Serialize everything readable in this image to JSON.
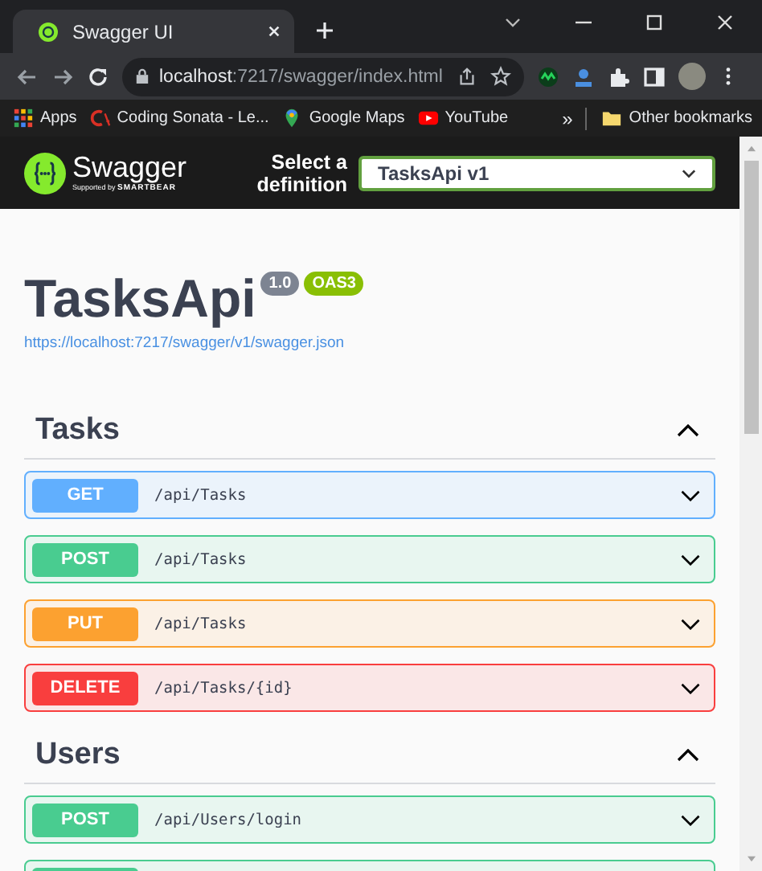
{
  "browser": {
    "tab_title": "Swagger UI",
    "address": {
      "host": "localhost",
      "rest": ":7217/swagger/index.html"
    },
    "bookmarks": [
      {
        "label": "Apps",
        "kind": "apps"
      },
      {
        "label": "Coding Sonata - Le...",
        "kind": "coding"
      },
      {
        "label": "Google Maps",
        "kind": "maps"
      },
      {
        "label": "YouTube",
        "kind": "youtube"
      }
    ],
    "more": "»",
    "other_bookmarks": "Other bookmarks"
  },
  "topbar": {
    "brand": "Swagger",
    "supported_by": "Supported by",
    "smartbear": "SMARTBEAR",
    "select_label": "Select a definition",
    "definition": "TasksApi v1"
  },
  "info": {
    "title": "TasksApi",
    "version": "1.0",
    "oas": "OAS3",
    "spec_url": "https://localhost:7217/swagger/v1/swagger.json"
  },
  "sections": [
    {
      "name": "Tasks",
      "expanded": true,
      "operations": [
        {
          "kind": "get",
          "label": "GET",
          "path": "/api/Tasks"
        },
        {
          "kind": "post",
          "label": "POST",
          "path": "/api/Tasks"
        },
        {
          "kind": "put",
          "label": "PUT",
          "path": "/api/Tasks"
        },
        {
          "kind": "delete",
          "label": "DELETE",
          "path": "/api/Tasks/{id}"
        }
      ]
    },
    {
      "name": "Users",
      "expanded": true,
      "operations": [
        {
          "kind": "post",
          "label": "POST",
          "path": "/api/Users/login"
        },
        {
          "kind": "post"
        }
      ]
    }
  ]
}
